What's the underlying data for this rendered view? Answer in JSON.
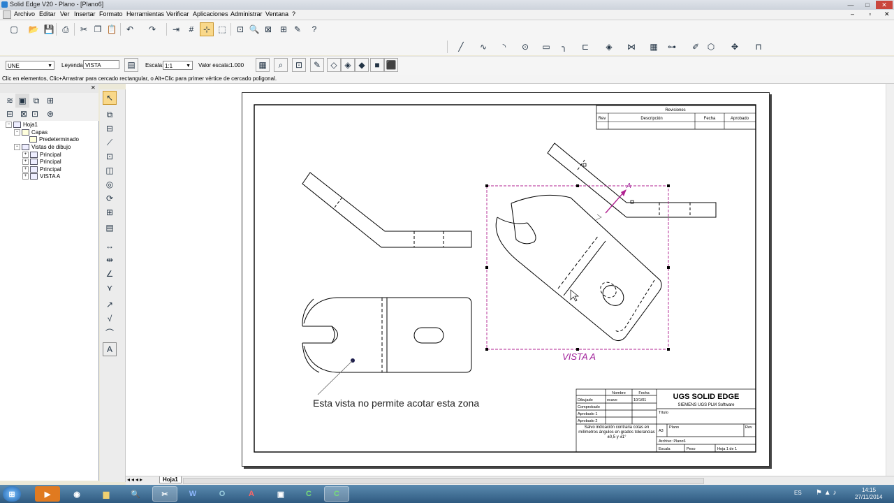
{
  "window": {
    "title": "Solid Edge V20 - Plano - [Plano6]",
    "minimize": "—",
    "maximize": "□",
    "close": "✕"
  },
  "menu": [
    "Archivo",
    "Editar",
    "Ver",
    "Insertar",
    "Formato",
    "Herramientas",
    "Verificar",
    "Aplicaciones",
    "Administrar",
    "Ventana",
    "?"
  ],
  "ribbon": {
    "style_value": "UNE",
    "leyenda_label": "Leyenda:",
    "leyenda_value": "VISTA",
    "escala_label": "Escala:",
    "escala_value": "1:1",
    "valor_escala_label": "Valor escala:",
    "valor_escala_value": "1.000"
  },
  "prompt": "Clic en elementos, Clic+Arrastrar para cercado rectangular, o Alt+Clic para primer vértice de cercado poligonal.",
  "tree": {
    "root": "Hoja1",
    "capas": "Capas",
    "predeterminado": "Predeterminado",
    "vistas": "Vistas de dibujo",
    "views": [
      "Principal",
      "Principal",
      "Principal",
      "VISTA A"
    ]
  },
  "drawing": {
    "revisions_title": "Revisiones",
    "rev_cols": [
      "Rev",
      "Descripción",
      "Fecha",
      "Aprobado"
    ],
    "view_label": "VISTA A",
    "annotation": "Esta vista no permite acotar  esta zona",
    "view_letter": "A",
    "titleblock": {
      "col_nombre": "Nombre",
      "col_fecha": "Fecha",
      "rows": [
        "Dibujado",
        "Comprobado",
        "Aprobado 1",
        "Aprobado 2"
      ],
      "dibujado_nombre": "ecavo",
      "dibujado_fecha": "10/1/01",
      "company": "UGS SOLID EDGE",
      "company_sub": "SIEMENS UGS PLM Software",
      "titulo": "Título",
      "note": "Salvo indicación contraria cotas en milímetros ángulos en grados tolerancias ±0,5 y ±1°",
      "size": "A3",
      "plano": "Plano",
      "rev": "Rev",
      "archivo": "Archivo: Plano6",
      "escala": "Escala",
      "peso": "Peso",
      "hoja": "Hoja 1 de 1"
    }
  },
  "sheet_tab": "Hoja1",
  "taskbar": {
    "apps": [
      "Windows",
      "Windows Media Player",
      "Chrome",
      "Explorer",
      "Lupa",
      "Cortar",
      "Word",
      "Outlook",
      "Acrobat",
      "Escritorio",
      "Excel",
      "Solid Edge"
    ],
    "lang": "ES",
    "time": "14:15",
    "date": "27/11/2014"
  },
  "colors": {
    "selection": "#b02090",
    "view_label": "#a0209a",
    "taskbar": "#2f5a80"
  }
}
